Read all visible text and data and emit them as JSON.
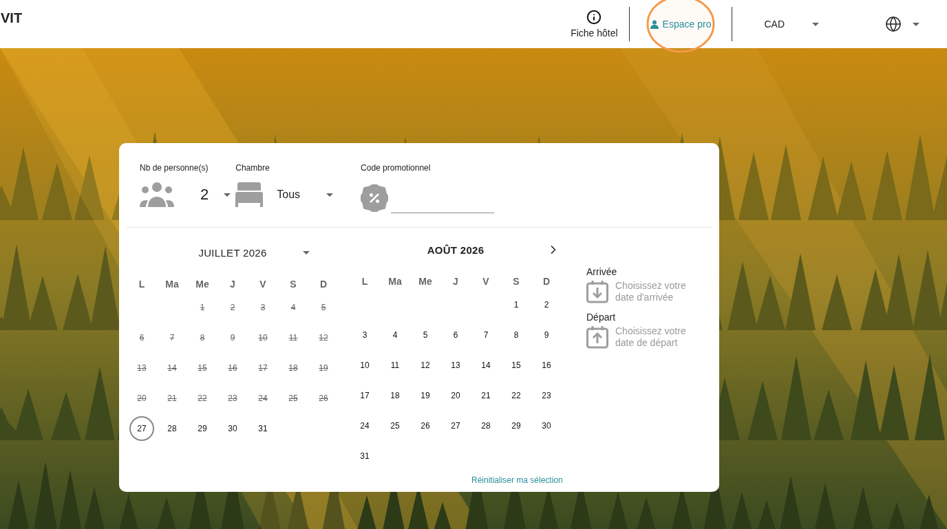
{
  "header": {
    "logo": "VIT",
    "nav": [
      {
        "kind": "info",
        "label": "Fiche hôtel",
        "circled": false
      },
      {
        "kind": "account",
        "label": "Espace pro",
        "circled": true
      },
      {
        "kind": "currency",
        "label": "CAD",
        "circled": false
      },
      {
        "kind": "language",
        "circled": false
      }
    ]
  },
  "search": {
    "persons": {
      "label": "Nb de personne(s)",
      "value": "2"
    },
    "room": {
      "label": "Chambre",
      "value": "Tous"
    },
    "promo": {
      "label": "Code promotionnel"
    }
  },
  "calendars": [
    {
      "title": "JUILLET 2026",
      "month_menu": true,
      "next_button": false,
      "weekdays": [
        "L",
        "Ma",
        "Me",
        "J",
        "V",
        "S",
        "D"
      ],
      "weeks": [
        [
          {
            "kind": "blank"
          },
          {
            "kind": "blank"
          },
          {
            "kind": "day",
            "label": "1",
            "disabled": true,
            "today": false
          },
          {
            "kind": "day",
            "label": "2",
            "disabled": true,
            "today": false
          },
          {
            "kind": "day",
            "label": "3",
            "disabled": true,
            "today": false
          },
          {
            "kind": "day",
            "label": "4",
            "disabled": true,
            "today": false
          },
          {
            "kind": "day",
            "label": "5",
            "disabled": true,
            "today": false
          }
        ],
        [
          {
            "kind": "day",
            "label": "6",
            "disabled": true,
            "today": false
          },
          {
            "kind": "day",
            "label": "7",
            "disabled": true,
            "today": false
          },
          {
            "kind": "day",
            "label": "8",
            "disabled": true,
            "today": false
          },
          {
            "kind": "day",
            "label": "9",
            "disabled": true,
            "today": false
          },
          {
            "kind": "day",
            "label": "10",
            "disabled": true,
            "today": false
          },
          {
            "kind": "day",
            "label": "11",
            "disabled": true,
            "today": false
          },
          {
            "kind": "day",
            "label": "12",
            "disabled": true,
            "today": false
          }
        ],
        [
          {
            "kind": "day",
            "label": "13",
            "disabled": true,
            "today": false
          },
          {
            "kind": "day",
            "label": "14",
            "disabled": true,
            "today": false
          },
          {
            "kind": "day",
            "label": "15",
            "disabled": true,
            "today": false
          },
          {
            "kind": "day",
            "label": "16",
            "disabled": true,
            "today": false
          },
          {
            "kind": "day",
            "label": "17",
            "disabled": true,
            "today": false
          },
          {
            "kind": "day",
            "label": "18",
            "disabled": true,
            "today": false
          },
          {
            "kind": "day",
            "label": "19",
            "disabled": true,
            "today": false
          }
        ],
        [
          {
            "kind": "day",
            "label": "20",
            "disabled": true,
            "today": false
          },
          {
            "kind": "day",
            "label": "21",
            "disabled": true,
            "today": false
          },
          {
            "kind": "day",
            "label": "22",
            "disabled": true,
            "today": false
          },
          {
            "kind": "day",
            "label": "23",
            "disabled": true,
            "today": false
          },
          {
            "kind": "day",
            "label": "24",
            "disabled": true,
            "today": false
          },
          {
            "kind": "day",
            "label": "25",
            "disabled": true,
            "today": false
          },
          {
            "kind": "day",
            "label": "26",
            "disabled": true,
            "today": false
          }
        ],
        [
          {
            "kind": "day",
            "label": "27",
            "disabled": false,
            "today": true
          },
          {
            "kind": "day",
            "label": "28",
            "disabled": false,
            "today": false
          },
          {
            "kind": "day",
            "label": "29",
            "disabled": false,
            "today": false
          },
          {
            "kind": "day",
            "label": "30",
            "disabled": false,
            "today": false
          },
          {
            "kind": "day",
            "label": "31",
            "disabled": false,
            "today": false
          }
        ]
      ]
    },
    {
      "title": "AOÛT 2026",
      "month_menu": false,
      "next_button": true,
      "weekdays": [
        "L",
        "Ma",
        "Me",
        "J",
        "V",
        "S",
        "D"
      ],
      "weeks": [
        [
          {
            "kind": "blank"
          },
          {
            "kind": "blank"
          },
          {
            "kind": "blank"
          },
          {
            "kind": "blank"
          },
          {
            "kind": "blank"
          },
          {
            "kind": "day",
            "label": "1",
            "disabled": false,
            "today": false
          },
          {
            "kind": "day",
            "label": "2",
            "disabled": false,
            "today": false
          }
        ],
        [
          {
            "kind": "day",
            "label": "3",
            "disabled": false,
            "today": false
          },
          {
            "kind": "day",
            "label": "4",
            "disabled": false,
            "today": false
          },
          {
            "kind": "day",
            "label": "5",
            "disabled": false,
            "today": false
          },
          {
            "kind": "day",
            "label": "6",
            "disabled": false,
            "today": false
          },
          {
            "kind": "day",
            "label": "7",
            "disabled": false,
            "today": false
          },
          {
            "kind": "day",
            "label": "8",
            "disabled": false,
            "today": false
          },
          {
            "kind": "day",
            "label": "9",
            "disabled": false,
            "today": false
          }
        ],
        [
          {
            "kind": "day",
            "label": "10",
            "disabled": false,
            "today": false
          },
          {
            "kind": "day",
            "label": "11",
            "disabled": false,
            "today": false
          },
          {
            "kind": "day",
            "label": "12",
            "disabled": false,
            "today": false
          },
          {
            "kind": "day",
            "label": "13",
            "disabled": false,
            "today": false
          },
          {
            "kind": "day",
            "label": "14",
            "disabled": false,
            "today": false
          },
          {
            "kind": "day",
            "label": "15",
            "disabled": false,
            "today": false
          },
          {
            "kind": "day",
            "label": "16",
            "disabled": false,
            "today": false
          }
        ],
        [
          {
            "kind": "day",
            "label": "17",
            "disabled": false,
            "today": false
          },
          {
            "kind": "day",
            "label": "18",
            "disabled": false,
            "today": false
          },
          {
            "kind": "day",
            "label": "19",
            "disabled": false,
            "today": false
          },
          {
            "kind": "day",
            "label": "20",
            "disabled": false,
            "today": false
          },
          {
            "kind": "day",
            "label": "21",
            "disabled": false,
            "today": false
          },
          {
            "kind": "day",
            "label": "22",
            "disabled": false,
            "today": false
          },
          {
            "kind": "day",
            "label": "23",
            "disabled": false,
            "today": false
          }
        ],
        [
          {
            "kind": "day",
            "label": "24",
            "disabled": false,
            "today": false
          },
          {
            "kind": "day",
            "label": "25",
            "disabled": false,
            "today": false
          },
          {
            "kind": "day",
            "label": "26",
            "disabled": false,
            "today": false
          },
          {
            "kind": "day",
            "label": "27",
            "disabled": false,
            "today": false
          },
          {
            "kind": "day",
            "label": "28",
            "disabled": false,
            "today": false
          },
          {
            "kind": "day",
            "label": "29",
            "disabled": false,
            "today": false
          },
          {
            "kind": "day",
            "label": "30",
            "disabled": false,
            "today": false
          }
        ],
        [
          {
            "kind": "day",
            "label": "31",
            "disabled": false,
            "today": false
          }
        ]
      ]
    }
  ],
  "stay": [
    {
      "kind": "arrival",
      "label": "Arrivée",
      "hint": "Choisissez votre date d'arrivée"
    },
    {
      "kind": "departure",
      "label": "Départ",
      "hint": "Choisissez votre date de départ"
    }
  ],
  "reset_link": "Réinitialiser ma sélection"
}
